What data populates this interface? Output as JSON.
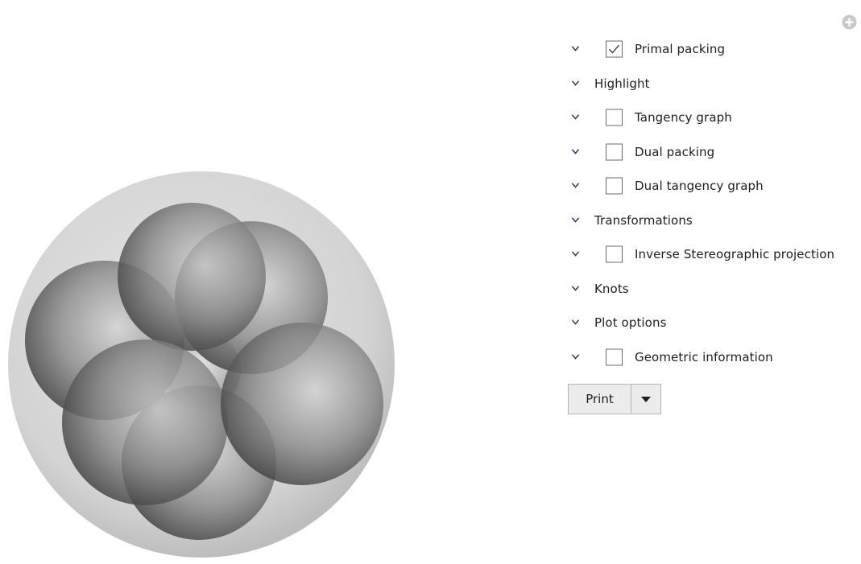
{
  "controls": [
    {
      "label": "Primal packing",
      "checkbox": true,
      "checked": true
    },
    {
      "label": "Highlight",
      "checkbox": false
    },
    {
      "label": "Tangency graph",
      "checkbox": true,
      "checked": false
    },
    {
      "label": "Dual packing",
      "checkbox": true,
      "checked": false
    },
    {
      "label": "Dual tangency graph",
      "checkbox": true,
      "checked": false
    },
    {
      "label": "Transformations",
      "checkbox": false
    },
    {
      "label": "Inverse Stereographic projection",
      "checkbox": true,
      "checked": false
    },
    {
      "label": "Knots",
      "checkbox": false
    },
    {
      "label": "Plot options",
      "checkbox": false
    },
    {
      "label": "Geometric information",
      "checkbox": true,
      "checked": false
    }
  ],
  "print": {
    "label": "Print"
  },
  "icons": {
    "chevron": "chevron-down-icon",
    "check": "check-icon",
    "add": "add-circle-icon",
    "dropdown": "caret-down-icon"
  },
  "colors": {
    "chevron": "#1f3b73",
    "sphere_dark": "#5a5a5a",
    "sphere_light": "#c4c4c4",
    "outer_sphere": "#d9d9d9"
  }
}
